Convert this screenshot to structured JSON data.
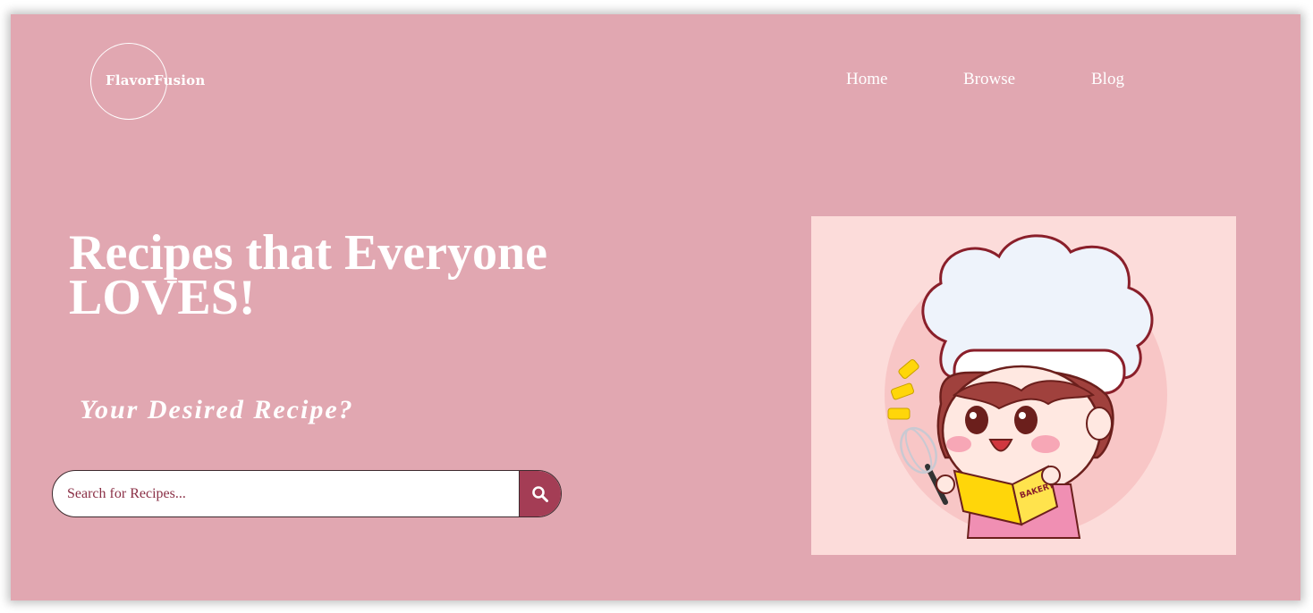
{
  "header": {
    "logo_text": "FlavorFusion",
    "nav": [
      {
        "label": "Home"
      },
      {
        "label": "Browse"
      },
      {
        "label": "Blog"
      }
    ]
  },
  "hero": {
    "title_line1": "Recipes that Everyone",
    "title_line2": "LOVES!",
    "subtitle": "Your Desired Recipe?",
    "search": {
      "placeholder": "Search for Recipes...",
      "value": ""
    },
    "illustration": {
      "book_label": "BAKERY",
      "icon": "chef-girl-illustration"
    }
  },
  "colors": {
    "background": "#e1a7b1",
    "accent": "#a43d55",
    "illustration_bg": "#fcdcda",
    "text": "#ffffff"
  }
}
